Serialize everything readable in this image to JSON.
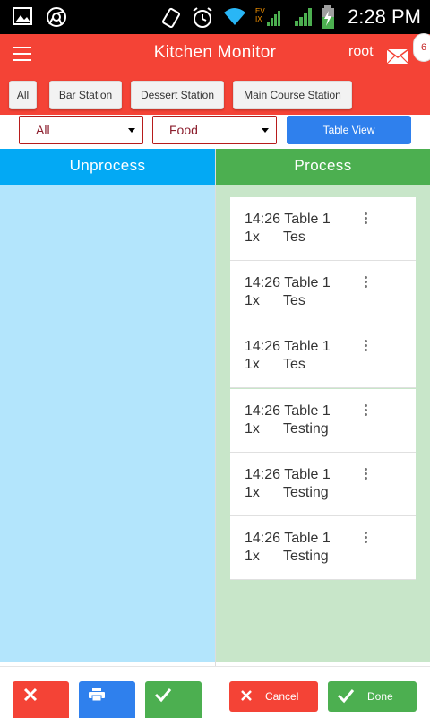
{
  "status_bar": {
    "time": "2:28 PM",
    "network_label_top": "EV",
    "network_label_bottom": "IX"
  },
  "app_bar": {
    "title": "Kitchen Monitor",
    "user": "root",
    "notification_count": "6"
  },
  "stations": [
    "All",
    "Bar Station",
    "Dessert Station",
    "Main Course Station"
  ],
  "filters": {
    "status_selected": "All",
    "category_selected": "Food",
    "table_view_label": "Table View"
  },
  "columns": {
    "unprocess": {
      "title": "Unprocess",
      "color": "#03a9f4",
      "bg": "#b3e5fc"
    },
    "process": {
      "title": "Process",
      "color": "#4caf50",
      "bg": "#c8e6c9"
    }
  },
  "process_orders": [
    {
      "time": "14:26",
      "table": "Table 1",
      "qty": "1x",
      "item": "Tes"
    },
    {
      "time": "14:26",
      "table": "Table 1",
      "qty": "1x",
      "item": "Tes"
    },
    {
      "time": "14:26",
      "table": "Table 1",
      "qty": "1x",
      "item": "Tes"
    },
    {
      "time": "14:26",
      "table": "Table 1",
      "qty": "1x",
      "item": "Testing"
    },
    {
      "time": "14:26",
      "table": "Table 1",
      "qty": "1x",
      "item": "Testing"
    },
    {
      "time": "14:26",
      "table": "Table 1",
      "qty": "1x",
      "item": "Testing"
    }
  ],
  "bottom_actions": {
    "cancel_label": "Cancel",
    "done_label": "Done",
    "red": "#f44336",
    "blue": "#2f80ed",
    "green": "#4caf50"
  }
}
